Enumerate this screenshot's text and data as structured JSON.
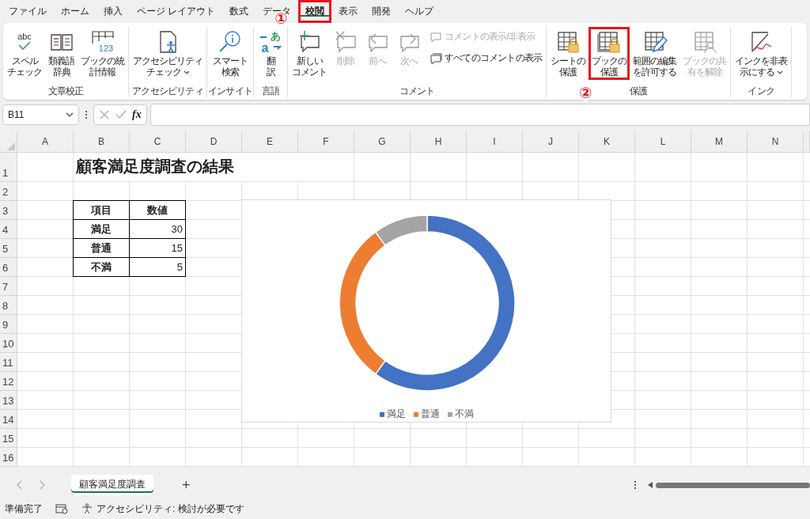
{
  "menu_tabs": [
    {
      "label": "ファイル",
      "selected": false,
      "highlighted": false
    },
    {
      "label": "ホーム",
      "selected": false,
      "highlighted": false
    },
    {
      "label": "挿入",
      "selected": false,
      "highlighted": false
    },
    {
      "label": "ページ レイアウト",
      "selected": false,
      "highlighted": false
    },
    {
      "label": "数式",
      "selected": false,
      "highlighted": false
    },
    {
      "label": "データ",
      "selected": false,
      "highlighted": false
    },
    {
      "label": "校閲",
      "selected": true,
      "highlighted": true,
      "marker": "①"
    },
    {
      "label": "表示",
      "selected": false,
      "highlighted": false
    },
    {
      "label": "開発",
      "selected": false,
      "highlighted": false
    },
    {
      "label": "ヘルプ",
      "selected": false,
      "highlighted": false
    }
  ],
  "ribbon": {
    "groups": [
      {
        "label": "文章校正",
        "buttons": [
          {
            "kind": "large",
            "label_lines": [
              "スペル",
              "チェック"
            ],
            "icon_text": "abc",
            "disabled": false,
            "highlighted": false,
            "dropdown": false
          },
          {
            "kind": "large",
            "label_lines": [
              "類義語",
              "辞典"
            ],
            "disabled": false,
            "highlighted": false,
            "dropdown": false
          },
          {
            "kind": "large",
            "label_lines": [
              "ブックの統",
              "計情報"
            ],
            "icon_text": "123",
            "disabled": false,
            "highlighted": false,
            "dropdown": false
          }
        ]
      },
      {
        "label": "アクセシビリティ",
        "buttons": [
          {
            "kind": "large",
            "label_lines": [
              "アクセシビリティ",
              "チェック"
            ],
            "disabled": false,
            "highlighted": false,
            "dropdown": true
          }
        ]
      },
      {
        "label": "インサイト",
        "buttons": [
          {
            "kind": "large",
            "label_lines": [
              "スマート",
              "検索"
            ],
            "disabled": false,
            "highlighted": false,
            "dropdown": false
          }
        ]
      },
      {
        "label": "言語",
        "buttons": [
          {
            "kind": "large",
            "label_lines": [
              "翻",
              "訳"
            ],
            "icon_text": "あa",
            "disabled": false,
            "highlighted": false,
            "dropdown": false
          }
        ]
      },
      {
        "label": "コメント",
        "buttons": [
          {
            "kind": "large",
            "label_lines": [
              "新しい",
              "コメント"
            ],
            "disabled": false,
            "highlighted": false,
            "dropdown": false
          },
          {
            "kind": "large",
            "label_lines": [
              "削除"
            ],
            "disabled": true,
            "highlighted": false,
            "dropdown": false
          },
          {
            "kind": "large",
            "label_lines": [
              "前へ"
            ],
            "disabled": true,
            "highlighted": false,
            "dropdown": false
          },
          {
            "kind": "large",
            "label_lines": [
              "次へ"
            ],
            "disabled": true,
            "highlighted": false,
            "dropdown": false
          },
          {
            "kind": "small",
            "label_lines": [
              "コメントの表示/非表示"
            ],
            "disabled": true,
            "highlighted": false,
            "dropdown": false
          },
          {
            "kind": "small",
            "label_lines": [
              "すべてのコメントの表示"
            ],
            "disabled": false,
            "highlighted": false,
            "dropdown": false
          }
        ]
      },
      {
        "label": "保護",
        "buttons": [
          {
            "kind": "large",
            "label_lines": [
              "シートの",
              "保護"
            ],
            "disabled": false,
            "highlighted": false,
            "dropdown": false
          },
          {
            "kind": "large",
            "label_lines": [
              "ブックの",
              "保護"
            ],
            "disabled": false,
            "highlighted": true,
            "dropdown": false,
            "marker": "②"
          },
          {
            "kind": "large",
            "label_lines": [
              "範囲の編集",
              "を許可する"
            ],
            "disabled": false,
            "highlighted": false,
            "dropdown": false
          },
          {
            "kind": "large",
            "label_lines": [
              "ブックの共",
              "有を解除"
            ],
            "disabled": true,
            "highlighted": false,
            "dropdown": false
          }
        ]
      },
      {
        "label": "インク",
        "buttons": [
          {
            "kind": "large",
            "label_lines": [
              "インクを非表",
              "示にする"
            ],
            "disabled": false,
            "highlighted": false,
            "dropdown": true
          }
        ]
      }
    ]
  },
  "formula_bar": {
    "name_box": "B11",
    "function_label": "fx"
  },
  "sheet": {
    "columns": [
      "A",
      "B",
      "C",
      "D",
      "E",
      "F",
      "G",
      "H",
      "I",
      "J",
      "K",
      "L",
      "M",
      "N"
    ],
    "row_labels": [
      "1",
      "2",
      "3",
      "4",
      "5",
      "6",
      "7",
      "8",
      "9",
      "10",
      "11",
      "12",
      "13",
      "14",
      "15",
      "16"
    ],
    "title": "顧客満足度調査の結果",
    "table": {
      "header": [
        "項目",
        "数値"
      ],
      "rows": [
        [
          "満足",
          "30"
        ],
        [
          "普通",
          "15"
        ],
        [
          "不満",
          "5"
        ]
      ]
    },
    "chart": {
      "chart_data": {
        "type": "donut",
        "categories": [
          "満足",
          "普通",
          "不満"
        ],
        "legend": "bottom",
        "series": [
          {
            "values": [
              60,
              30,
              10
            ]
          }
        ]
      },
      "slices": [
        {
          "color": "#4472c4"
        },
        {
          "color": "#ed7d31"
        },
        {
          "color": "#a5a5a5"
        }
      ]
    }
  },
  "sheet_tabs": {
    "tabs": [
      {
        "label": "顧客満足度調査",
        "selected": true
      }
    ],
    "add": "+"
  },
  "status_bar": {
    "ready": "準備完了",
    "accessibility": "アクセシビリティ: 検討が必要です"
  }
}
